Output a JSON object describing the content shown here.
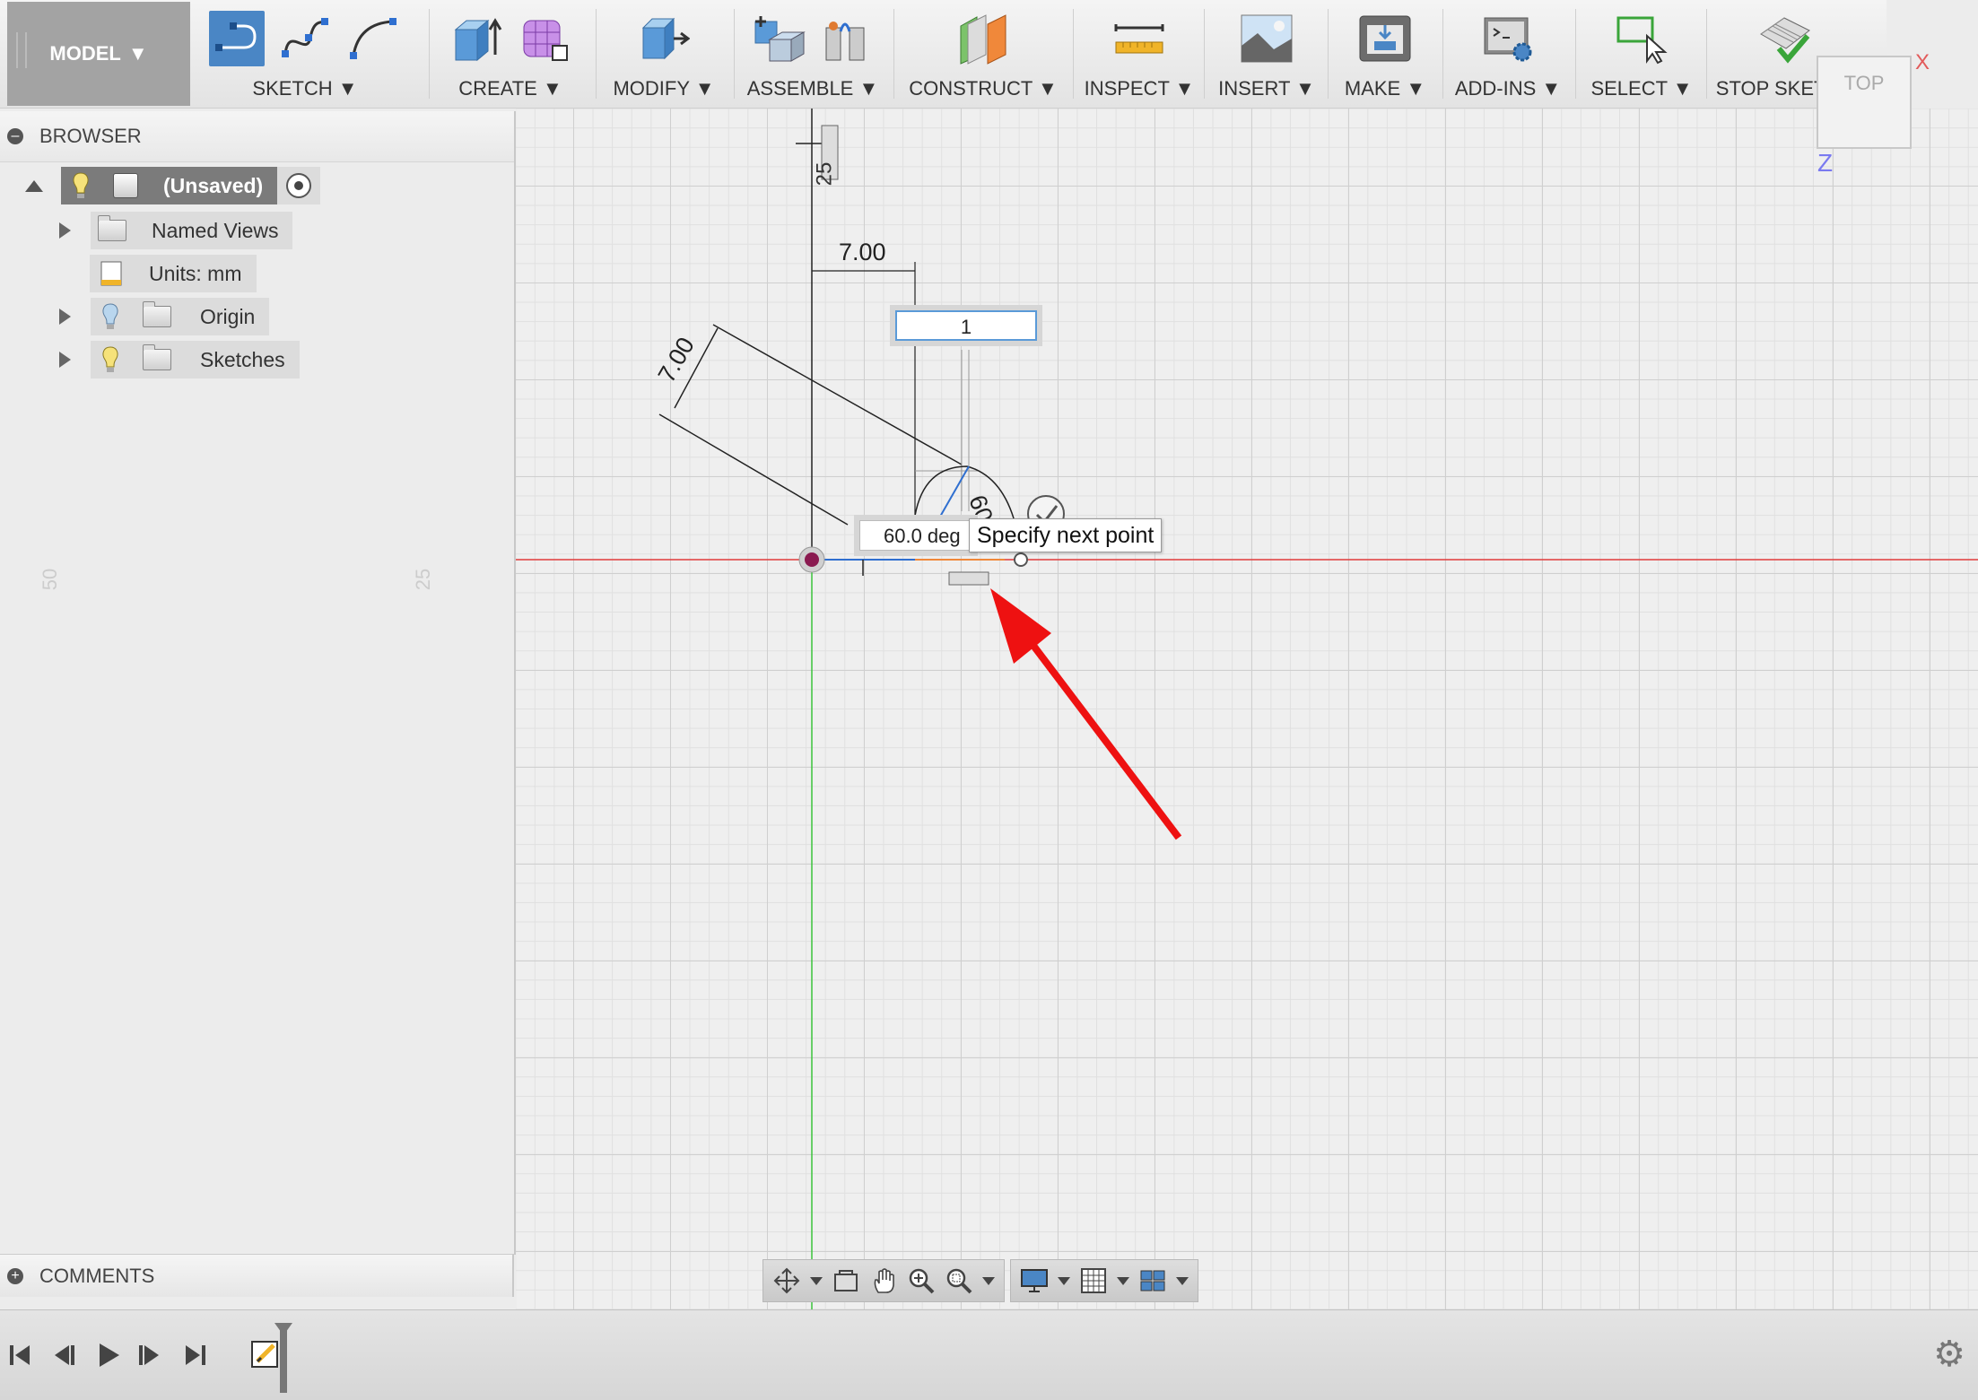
{
  "toolbar": {
    "model_label": "MODEL",
    "groups": [
      {
        "label": "SKETCH",
        "icons": [
          "line-icon",
          "spline-icon",
          "arc-icon"
        ]
      },
      {
        "label": "CREATE",
        "icons": [
          "extrude-icon",
          "form-icon"
        ]
      },
      {
        "label": "MODIFY",
        "icons": [
          "press-pull-icon"
        ]
      },
      {
        "label": "ASSEMBLE",
        "icons": [
          "new-component-icon",
          "joint-icon"
        ]
      },
      {
        "label": "CONSTRUCT",
        "icons": [
          "offset-plane-icon"
        ]
      },
      {
        "label": "INSPECT",
        "icons": [
          "measure-icon"
        ]
      },
      {
        "label": "INSERT",
        "icons": [
          "insert-image-icon"
        ]
      },
      {
        "label": "MAKE",
        "icons": [
          "3d-print-icon"
        ]
      },
      {
        "label": "ADD-INS",
        "icons": [
          "scripts-icon"
        ]
      },
      {
        "label": "SELECT",
        "icons": [
          "select-icon"
        ]
      },
      {
        "label": "STOP SKETCH",
        "icons": [
          "stop-sketch-icon"
        ]
      }
    ]
  },
  "browser": {
    "title": "BROWSER",
    "root_label": "(Unsaved)",
    "items": [
      {
        "label": "Named Views"
      },
      {
        "label": "Units: mm"
      },
      {
        "label": "Origin"
      },
      {
        "label": "Sketches"
      }
    ]
  },
  "comments": {
    "title": "COMMENTS"
  },
  "canvas": {
    "dim_horizontal": "7.00",
    "dim_angled": "7.00",
    "dim_vertical": "25",
    "angle_label": "60",
    "ruler_labels": [
      "50",
      "25"
    ],
    "length_input_value": "1",
    "angle_input_value": "60.0 deg",
    "tooltip": "Specify next point",
    "viewcube_label": "TOP",
    "axis_x": "X",
    "axis_z": "Z"
  },
  "colors": {
    "accent": "#4a86c5",
    "x_axis": "#e03c3c",
    "y_axis": "#3cc43c",
    "arrow": "#ee1111"
  }
}
